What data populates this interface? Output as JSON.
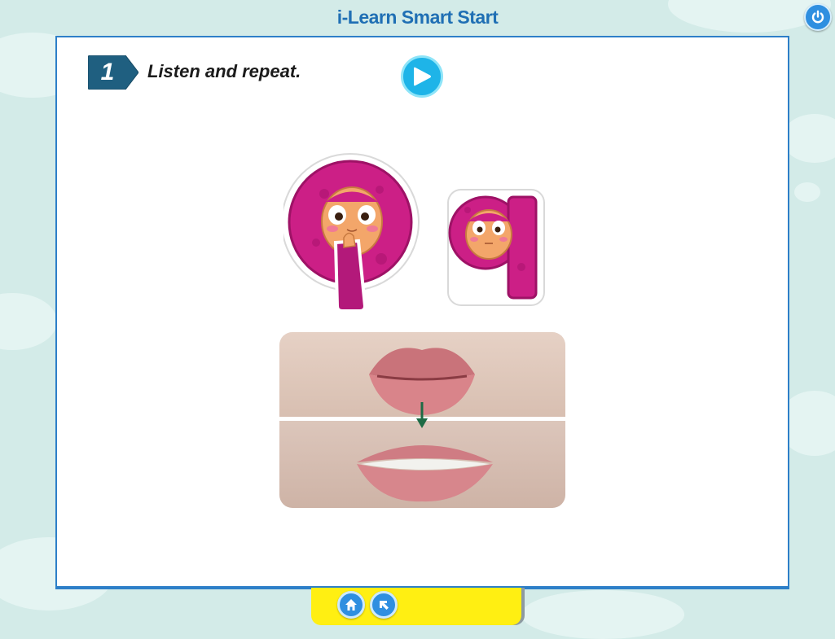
{
  "app": {
    "title": "i-Learn Smart Start"
  },
  "header": {
    "power_icon": "power-icon"
  },
  "activity": {
    "step_number": "1",
    "instruction": "Listen and repeat.",
    "play_icon": "play-icon"
  },
  "content": {
    "uppercase_letter": "Q",
    "lowercase_letter": "q",
    "letter_color": "#cc1f86",
    "mouth_image": "mouth-shape-photos"
  },
  "footer": {
    "home_icon": "home-icon",
    "back_icon": "back-arrow-icon"
  },
  "colors": {
    "accent": "#2d7fc8",
    "play_button": "#1eb4e8",
    "footer_bar": "#ffef12",
    "background": "#d3ebe8"
  }
}
